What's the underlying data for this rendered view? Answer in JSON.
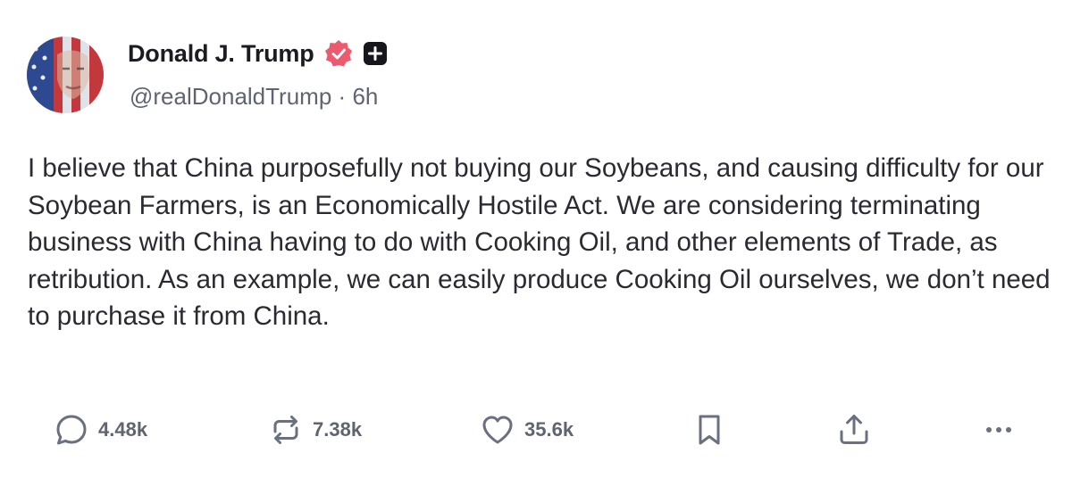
{
  "post": {
    "author": {
      "display_name": "Donald J. Trump",
      "handle": "@realDonaldTrump",
      "separator": "·",
      "time_ago": "6h",
      "verified_color": "#ec5a6e"
    },
    "text": "I believe that China purposefully not buying our Soybeans, and causing difficulty for our Soybean Farmers, is an Economically Hostile Act. We are considering terminating business with China having to do with Cooking Oil, and other elements of Trade, as retribution. As an example, we can easily produce Cooking Oil ourselves, we don’t need to purchase it from China.",
    "actions": {
      "replies": "4.48k",
      "reposts": "7.38k",
      "likes": "35.6k"
    },
    "icons": {
      "reply": "speech-bubble-icon",
      "repost": "repost-arrows-icon",
      "like": "heart-icon",
      "bookmark": "bookmark-icon",
      "share": "share-upload-icon",
      "more": "more-dots-icon",
      "verified": "verified-badge-icon",
      "plus": "plus-badge-icon"
    },
    "colors": {
      "text": "#2a2a32",
      "secondary": "#5f6470",
      "icon": "#6b7080"
    }
  }
}
